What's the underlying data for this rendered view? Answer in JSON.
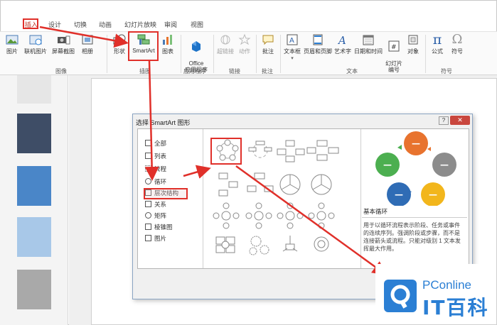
{
  "tabs": [
    "插入",
    "设计",
    "切换",
    "动画",
    "幻灯片放映",
    "审阅",
    "视图"
  ],
  "ribbon": {
    "buttons": [
      "图片",
      "联机图片",
      "屏幕截图",
      "相册",
      "形状",
      "SmartArt",
      "图表",
      "Office\n应用程序",
      "超链接",
      "动作",
      "批注",
      "文本框",
      "页眉和页脚",
      "艺术字",
      "日期和时间",
      "幻灯片\n编号",
      "对象",
      "公式",
      "符号"
    ],
    "groups": [
      "图像",
      "插图",
      "应用程序",
      "链接",
      "批注",
      "文本",
      "符号"
    ],
    "dropdown_mark": "▾",
    "equation_glyph": "π",
    "symbol_glyph": "Ω"
  },
  "dialog": {
    "title": "选择 SmartArt 图形",
    "help": "?",
    "close": "✕",
    "categories": [
      "全部",
      "列表",
      "流程",
      "循环",
      "层次结构",
      "关系",
      "矩阵",
      "棱锥图",
      "图片"
    ],
    "preview_title": "基本循环",
    "preview_desc": "用于以循环流程表示阶段、任务或事件的连续序列。强调阶段或步骤，而不是连接箭头或流程。只能对级别 1 文本发挥最大作用。",
    "preview_node_glyph": "—"
  },
  "watermark": {
    "brand": "PConline",
    "cn": "IT百科"
  },
  "colors": {
    "accent_red": "#e0302a",
    "cycle_orange": "#e8732e",
    "cycle_gray": "#8c8c8c",
    "cycle_yellow": "#f2b61c",
    "cycle_blue": "#2f6cb5",
    "cycle_green": "#4caf50",
    "logo_blue": "#2b7fd4"
  }
}
